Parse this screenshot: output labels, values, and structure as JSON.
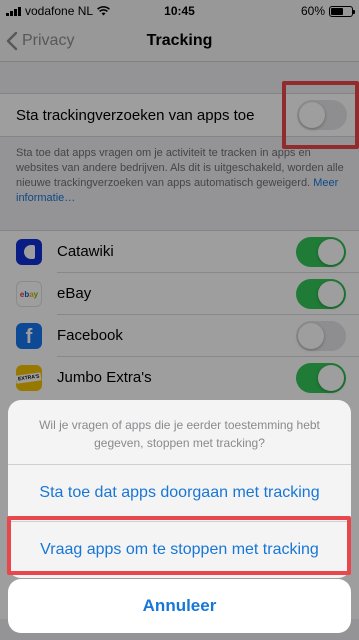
{
  "status_bar": {
    "carrier": "vodafone NL",
    "time": "10:45",
    "battery": "60%",
    "battery_level": 0.6
  },
  "nav": {
    "back_label": "Privacy",
    "title": "Tracking"
  },
  "tracking_toggle": {
    "label": "Sta trackingverzoeken van apps toe",
    "state": "off"
  },
  "footer": {
    "text": "Sta toe dat apps vragen om je activiteit te tracken in apps en websites van andere bedrijven. Als dit is uitgeschakeld, worden alle nieuwe trackingverzoeken van apps automatisch geweigerd.",
    "link": "Meer informatie…"
  },
  "apps": [
    {
      "name": "Catawiki",
      "state": "on",
      "icon": "catawiki-icon"
    },
    {
      "name": "eBay",
      "state": "on",
      "icon": "ebay-icon"
    },
    {
      "name": "Facebook",
      "state": "off",
      "icon": "facebook-icon"
    },
    {
      "name": "Jumbo Extra's",
      "state": "on",
      "icon": "jumbo-extras-icon"
    }
  ],
  "icon_text": {
    "ebay": [
      "e",
      "b",
      "a",
      "y"
    ],
    "facebook": "f",
    "jumbo": "EXTRA'S"
  },
  "action_sheet": {
    "message": "Wil je vragen of apps die je eerder toestemming hebt gegeven, stoppen met tracking?",
    "allow_button": "Sta toe dat apps doorgaan met tracking",
    "ask_stop_button": "Vraag apps om te stoppen met tracking",
    "cancel_button": "Annuleer"
  },
  "colors": {
    "accent": "#1877d6",
    "toggle_on": "#34c759",
    "highlight": "#e8484b"
  }
}
